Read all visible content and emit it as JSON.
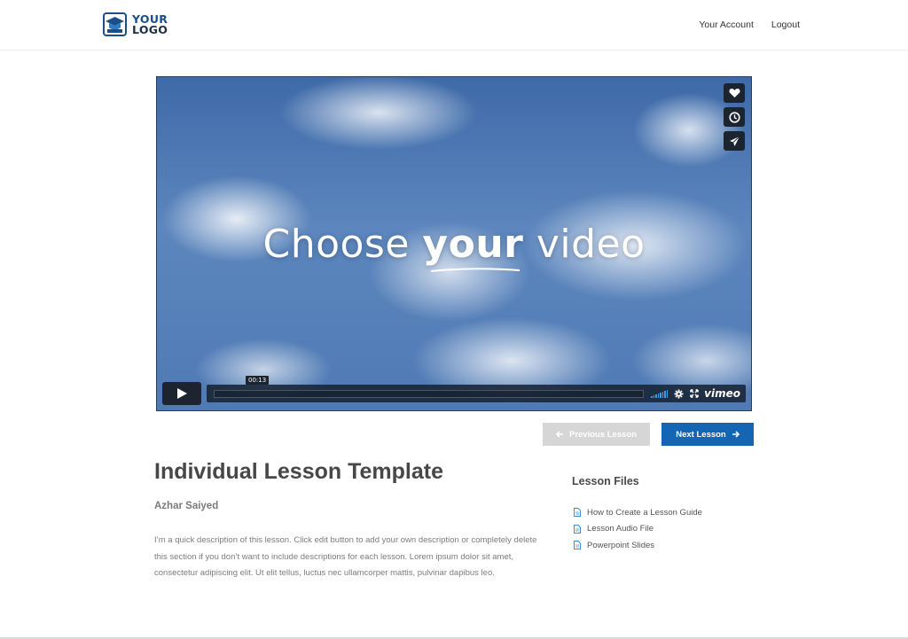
{
  "header": {
    "logo_line1": "YOUR",
    "logo_line2": "LOGO",
    "nav": [
      "Your Account",
      "Logout"
    ]
  },
  "video": {
    "title_pre": "Choose ",
    "title_bold": "your",
    "title_post": " video",
    "time": "00:13",
    "brand": "vimeo",
    "side_icons": [
      "heart-icon",
      "clock-icon",
      "send-icon"
    ]
  },
  "lesson_nav": {
    "prev_label": "Previous Lesson",
    "next_label": "Next Lesson"
  },
  "lesson": {
    "title": "Individual Lesson Template",
    "author": "Azhar Saiyed",
    "description": "I’m a quick description of this lesson. Click edit button to add your own description or completely delete this section if you don’t want to include descriptions for each lesson. Lorem ipsum dolor sit amet, consectetur adipiscing elit. Ut elit tellus, luctus nec ullamcorper mattis, pulvinar dapibus leo."
  },
  "files": {
    "title": "Lesson Files",
    "items": [
      "How to Create a Lesson Guide",
      "Lesson Audio File",
      "Powerpoint Slides"
    ]
  },
  "colors": {
    "brand": "#1b4f8a",
    "next_button": "#1565b5",
    "prev_button_disabled": "#d6d6d6",
    "file_icon": "#3a8fd6"
  }
}
